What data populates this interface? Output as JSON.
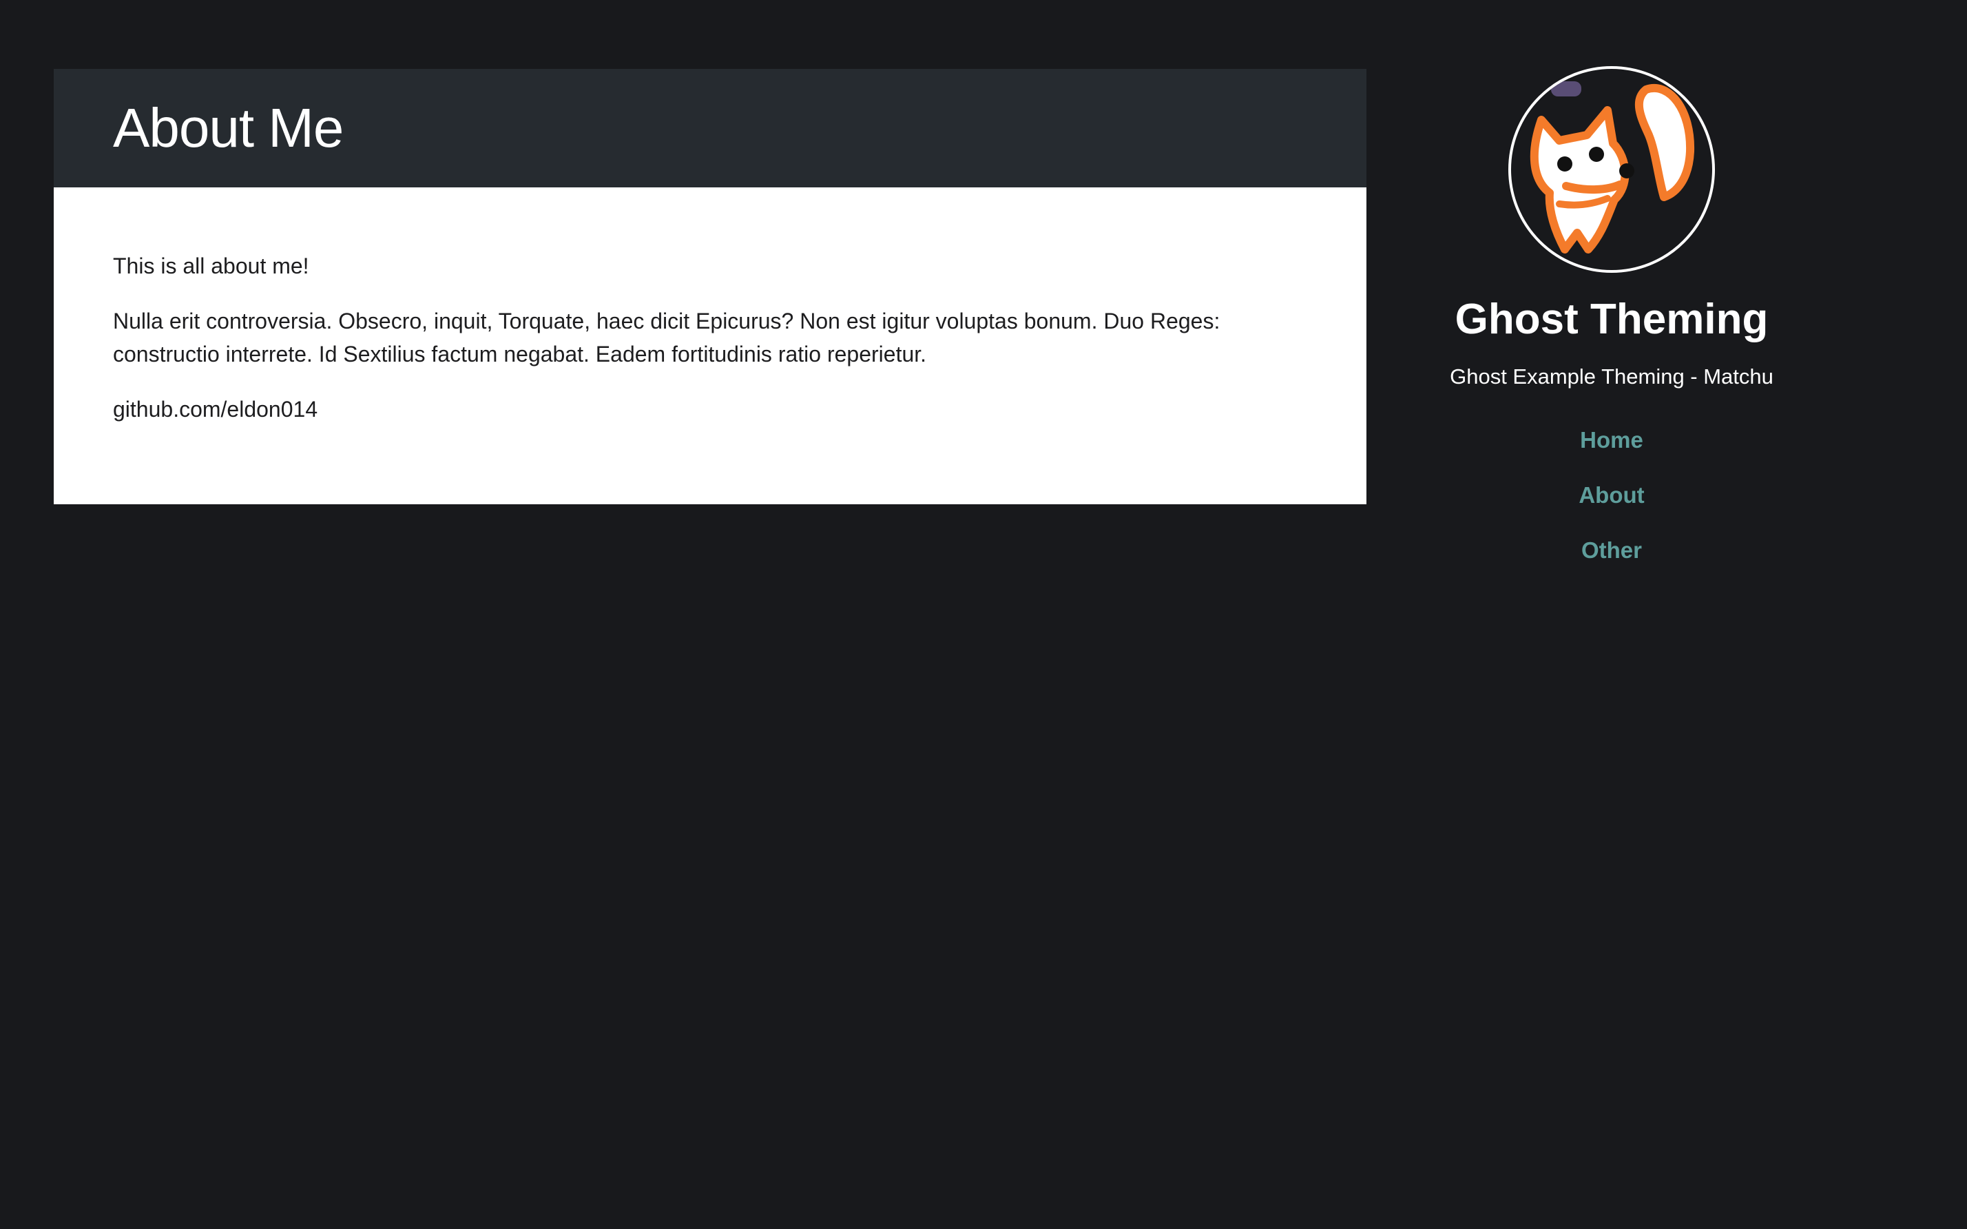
{
  "article": {
    "title": "About Me",
    "paragraphs": [
      "This is all about me!",
      "Nulla erit controversia. Obsecro, inquit, Torquate, haec dicit Epicurus? Non est igitur voluptas bonum. Duo Reges: constructio interrete. Id Sextilius factum negabat. Eadem fortitudinis ratio reperietur.",
      "github.com/eldon014"
    ]
  },
  "sidebar": {
    "avatar_icon": "cartoon-fox-icon",
    "site_title": "Ghost Theming",
    "site_description": "Ghost Example Theming - Matchu",
    "nav": [
      {
        "label": "Home"
      },
      {
        "label": "About"
      },
      {
        "label": "Other"
      }
    ]
  },
  "colors": {
    "background": "#18191c",
    "header": "#262b30",
    "card": "#ffffff",
    "nav_link": "#5e9e9c",
    "avatar_accent": "#f47b2a"
  }
}
